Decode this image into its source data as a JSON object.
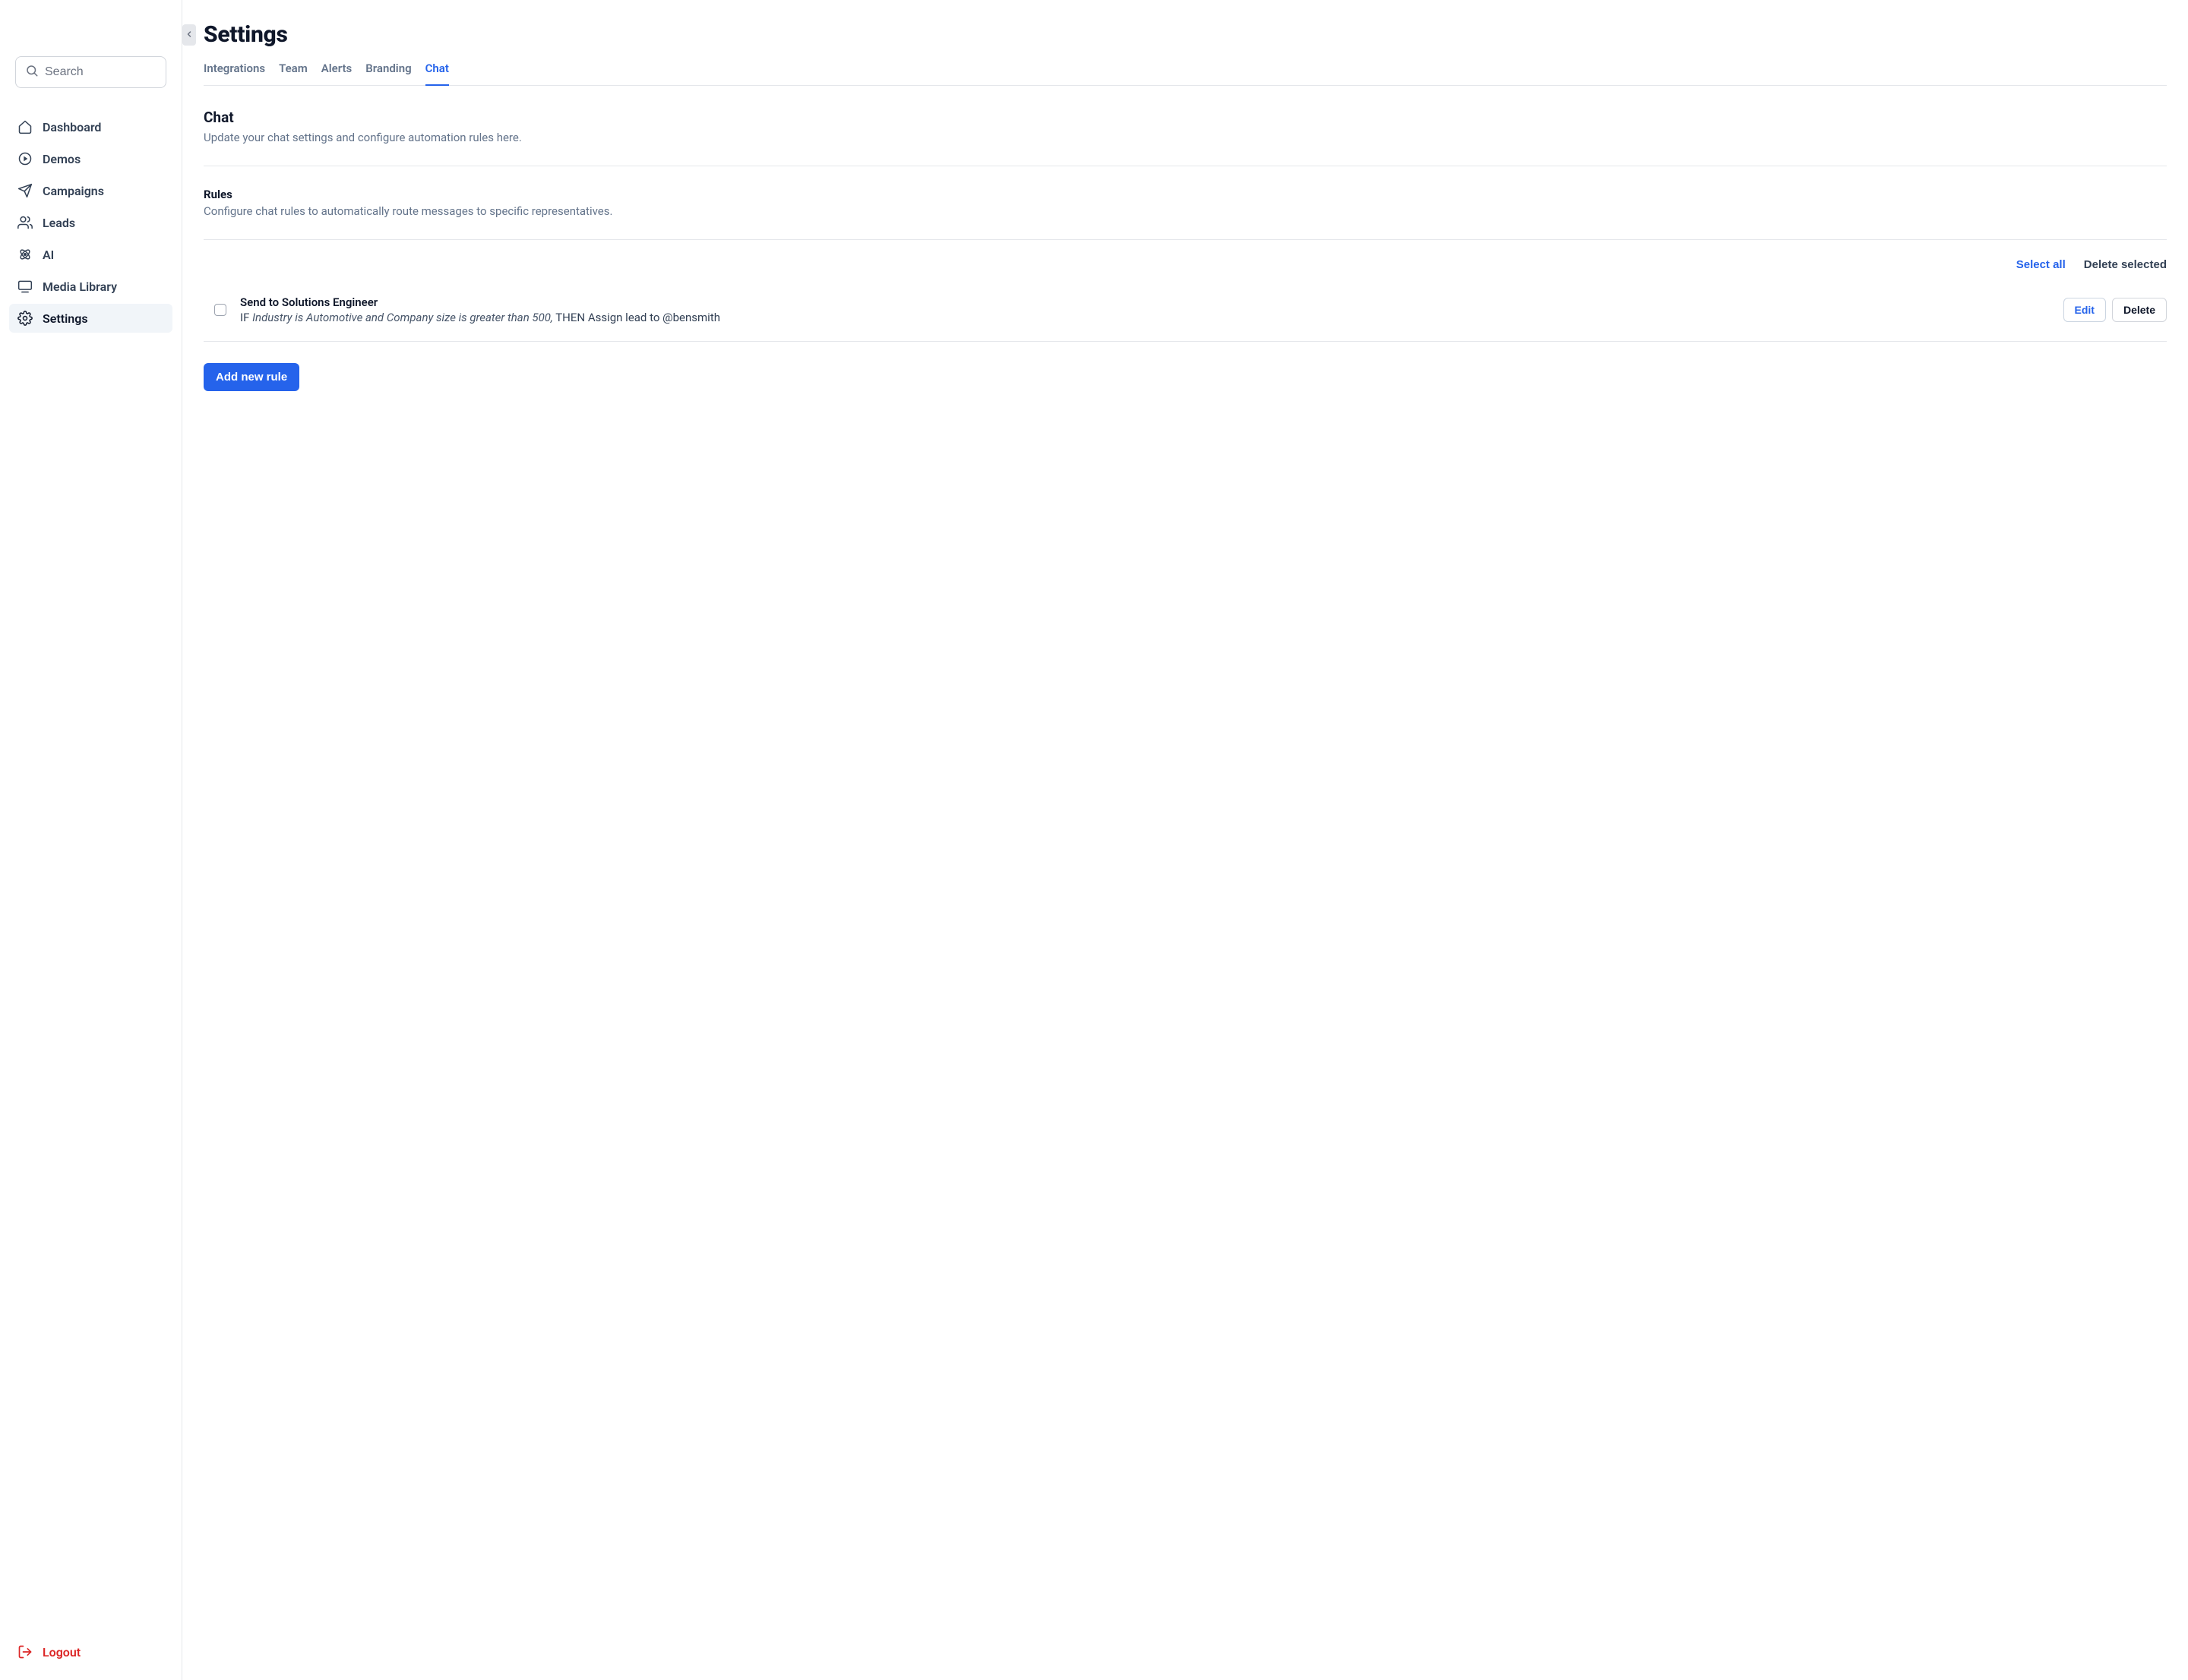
{
  "search": {
    "placeholder": "Search"
  },
  "sidebar": {
    "items": [
      {
        "label": "Dashboard"
      },
      {
        "label": "Demos"
      },
      {
        "label": "Campaigns"
      },
      {
        "label": "Leads"
      },
      {
        "label": "AI"
      },
      {
        "label": "Media Library"
      },
      {
        "label": "Settings"
      }
    ],
    "logout_label": "Logout"
  },
  "header": {
    "title": "Settings"
  },
  "tabs": [
    {
      "label": "Integrations"
    },
    {
      "label": "Team"
    },
    {
      "label": "Alerts"
    },
    {
      "label": "Branding"
    },
    {
      "label": "Chat"
    }
  ],
  "section": {
    "title": "Chat",
    "description": "Update your chat settings and configure automation rules here."
  },
  "rules": {
    "heading": "Rules",
    "description": "Configure chat rules to automatically route messages to specific representatives.",
    "select_all_label": "Select all",
    "delete_selected_label": "Delete selected",
    "items": [
      {
        "title": "Send to Solutions Engineer",
        "if_label": "IF ",
        "condition": "Industry is Automotive and Company size is greater than 500,",
        "then_label": " THEN ",
        "action": "Assign lead to @bensmith",
        "edit_label": "Edit",
        "delete_label": "Delete"
      }
    ],
    "add_label": "Add new rule"
  }
}
